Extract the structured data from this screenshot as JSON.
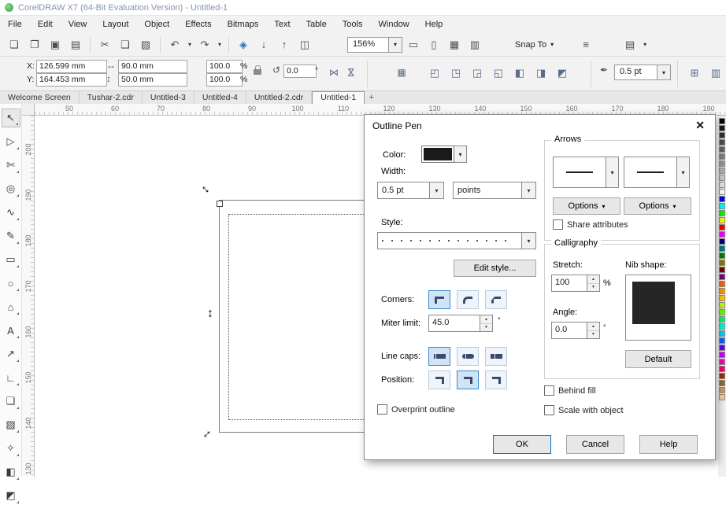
{
  "colors": {
    "accent": "#0078d7",
    "toggle_selected_fill": "#cfe4f7",
    "toggle_selected_border": "#3c87c8",
    "icon_navy": "#3d4a6b"
  },
  "icons": {
    "dropdown": "▾",
    "spin_up": "▲",
    "spin_down": "▼",
    "close": "✕",
    "resize_diag": "↔",
    "resize_v": "↕",
    "plus": "+"
  },
  "titlebar": {
    "title": "CorelDRAW X7 (64-Bit Evaluation Version) - Untitled-1"
  },
  "menubar": {
    "items": [
      "File",
      "Edit",
      "View",
      "Layout",
      "Object",
      "Effects",
      "Bitmaps",
      "Text",
      "Table",
      "Tools",
      "Window",
      "Help"
    ]
  },
  "toolbar": {
    "zoom_value": "156%",
    "snap_to_label": "Snap To",
    "glyphs": {
      "new": "❏",
      "open": "❐",
      "save": "▣",
      "print": "▤",
      "cut": "✂",
      "copy": "❑",
      "paste": "▨",
      "undo": "↶",
      "redo": "↷",
      "search_content": "◈",
      "import": "↓",
      "export": "↑",
      "publish_pdf": "◫",
      "fullscreen": "▭",
      "rulers": "▯",
      "grid": "▦",
      "guidelines": "▥",
      "options": "≡",
      "launcher": "▤"
    }
  },
  "propertybar": {
    "x_label": "X:",
    "x_value": "126.599 mm",
    "y_label": "Y:",
    "y_value": "164.453 mm",
    "width_value": "90.0 mm",
    "height_value": "50.0 mm",
    "scale_x_value": "100.0",
    "scale_y_value": "100.0",
    "percent": "%",
    "rotation_value": "0.0",
    "degree": "°",
    "outline_width_value": "0.5 pt",
    "glyphs": {
      "width": "↔",
      "height": "↕",
      "rotate": "↺",
      "mirror": "⋈",
      "nib": "✒"
    },
    "arrange_buttons": [
      {
        "glyph": "◰"
      },
      {
        "glyph": "◳"
      },
      {
        "glyph": "◲"
      },
      {
        "glyph": "◱"
      },
      {
        "glyph": "◧"
      },
      {
        "glyph": "◨"
      },
      {
        "glyph": "◩"
      }
    ],
    "right_buttons": [
      {
        "glyph": "⊞"
      },
      {
        "glyph": "▥"
      }
    ]
  },
  "tabs": {
    "items": [
      "Welcome Screen",
      "Tushar-2.cdr",
      "Untitled-3",
      "Untitled-4",
      "Untitled-2.cdr",
      "Untitled-1"
    ]
  },
  "rulers": {
    "h_ticks": [
      "50",
      "60",
      "70",
      "80",
      "90",
      "100",
      "110",
      "120",
      "130",
      "140",
      "150",
      "160",
      "170",
      "180",
      "190"
    ],
    "v_ticks": [
      "200",
      "190",
      "180",
      "170",
      "160",
      "150",
      "140",
      "130"
    ]
  },
  "toolbox": {
    "tools": [
      {
        "name": "pick-tool",
        "glyph": "↖",
        "cls": "sel"
      },
      {
        "name": "shape-tool",
        "glyph": "▷"
      },
      {
        "name": "crop-tool",
        "glyph": "✄"
      },
      {
        "name": "zoom-tool",
        "glyph": "◎"
      },
      {
        "name": "freehand-tool",
        "glyph": "∿"
      },
      {
        "name": "artistic-media-tool",
        "glyph": "✎"
      },
      {
        "name": "rectangle-tool",
        "glyph": "▭"
      },
      {
        "name": "ellipse-tool",
        "glyph": "○"
      },
      {
        "name": "polygon-tool",
        "glyph": "⌂"
      },
      {
        "name": "text-tool",
        "glyph": "A"
      },
      {
        "name": "parallel-dimension-tool",
        "glyph": "↗"
      },
      {
        "name": "connector-tool",
        "glyph": "∟"
      },
      {
        "name": "drop-shadow-tool",
        "glyph": "❏"
      },
      {
        "name": "transparency-tool",
        "glyph": "▨"
      },
      {
        "name": "color-eyedropper-tool",
        "glyph": "✧"
      },
      {
        "name": "interactive-fill-tool",
        "glyph": "◧"
      },
      {
        "name": "smart-fill-tool",
        "glyph": "◩"
      }
    ]
  },
  "palette": {
    "colors": [
      "#000000",
      "#1a1a1a",
      "#333333",
      "#4d4d4d",
      "#666666",
      "#808080",
      "#999999",
      "#b3b3b3",
      "#cccccc",
      "#e6e6e6",
      "#ffffff",
      "#0000ff",
      "#00ffff",
      "#00ff00",
      "#ffff00",
      "#ff0000",
      "#ff00ff",
      "#000080",
      "#008080",
      "#008000",
      "#808000",
      "#800000",
      "#800080",
      "#ff6600",
      "#ff9900",
      "#ffcc00",
      "#ccff00",
      "#66ff00",
      "#00ff66",
      "#00ffcc",
      "#00ccff",
      "#0066ff",
      "#6600ff",
      "#cc00ff",
      "#ff00cc",
      "#ff0066",
      "#993300",
      "#996633",
      "#cc9966",
      "#ffcc99"
    ]
  },
  "dialog": {
    "title": "Outline Pen",
    "color_label": "Color:",
    "width_label": "Width:",
    "width_value": "0.5 pt",
    "width_units": "points",
    "style_label": "Style:",
    "edit_style_label": "Edit style...",
    "corners_label": "Corners:",
    "miter_label": "Miter limit:",
    "miter_value": "45.0",
    "miter_unit": "°",
    "caps_label": "Line caps:",
    "position_label": "Position:",
    "overprint_label": "Overprint outline",
    "arrows": {
      "title": "Arrows",
      "options_label": "Options",
      "share_label": "Share attributes"
    },
    "calligraphy": {
      "title": "Calligraphy",
      "stretch_label": "Stretch:",
      "stretch_value": "100",
      "stretch_unit": "%",
      "nib_label": "Nib shape:",
      "angle_label": "Angle:",
      "angle_value": "0.0",
      "angle_unit": "°",
      "default_label": "Default"
    },
    "behind_fill_label": "Behind fill",
    "scale_with_object_label": "Scale with object",
    "ok_label": "OK",
    "cancel_label": "Cancel",
    "help_label": "Help"
  }
}
